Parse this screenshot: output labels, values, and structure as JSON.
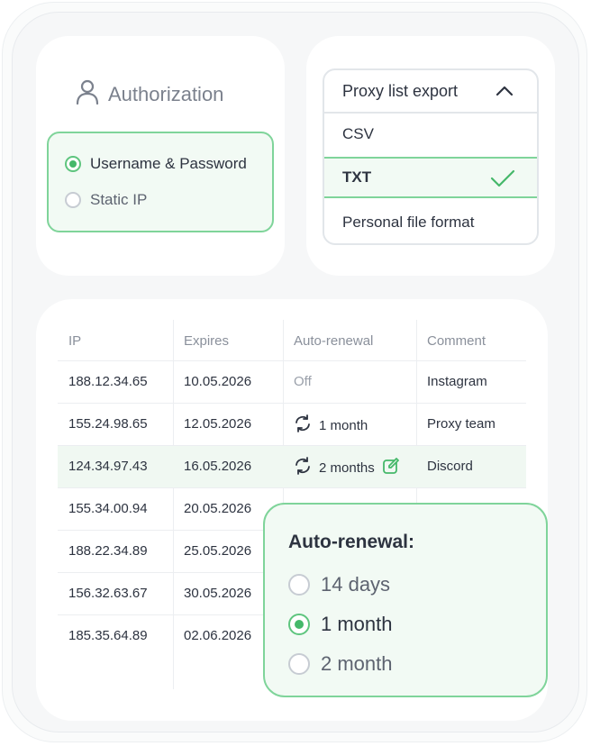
{
  "authorization": {
    "title": "Authorization",
    "icon": "user-icon",
    "options": [
      {
        "label": "Username & Password",
        "selected": true
      },
      {
        "label": "Static IP",
        "selected": false
      }
    ]
  },
  "export": {
    "title": "Proxy list export",
    "options": [
      {
        "label": "CSV",
        "selected": false
      },
      {
        "label": "TXT",
        "selected": true
      },
      {
        "label": "Personal file format",
        "selected": false
      }
    ]
  },
  "table": {
    "headers": [
      "IP",
      "Expires",
      "Auto-renewal",
      "Comment"
    ],
    "rows": [
      {
        "ip": "188.12.34.65",
        "expires": "10.05.2026",
        "renewal": "Off",
        "comment": "Instagram"
      },
      {
        "ip": "155.24.98.65",
        "expires": "12.05.2026",
        "renewal": "1 month",
        "comment": "Proxy team"
      },
      {
        "ip": "124.34.97.43",
        "expires": "16.05.2026",
        "renewal": "2 months",
        "comment": "Discord"
      },
      {
        "ip": "155.34.00.94",
        "expires": "20.05.2026",
        "renewal": "",
        "comment": ""
      },
      {
        "ip": "188.22.34.89",
        "expires": "25.05.2026",
        "renewal": "",
        "comment": ""
      },
      {
        "ip": "156.32.63.67",
        "expires": "30.05.2026",
        "renewal": "",
        "comment": ""
      },
      {
        "ip": "185.35.64.89",
        "expires": "02.06.2026",
        "renewal": "",
        "comment": ""
      }
    ]
  },
  "popup": {
    "title": "Auto-renewal:",
    "options": [
      {
        "label": "14 days",
        "selected": false
      },
      {
        "label": "1 month",
        "selected": true
      },
      {
        "label": "2 month",
        "selected": false
      }
    ]
  },
  "colors": {
    "accent": "#45b86a",
    "accent_border": "#7fd49a",
    "accent_bg": "#f2faf4"
  }
}
